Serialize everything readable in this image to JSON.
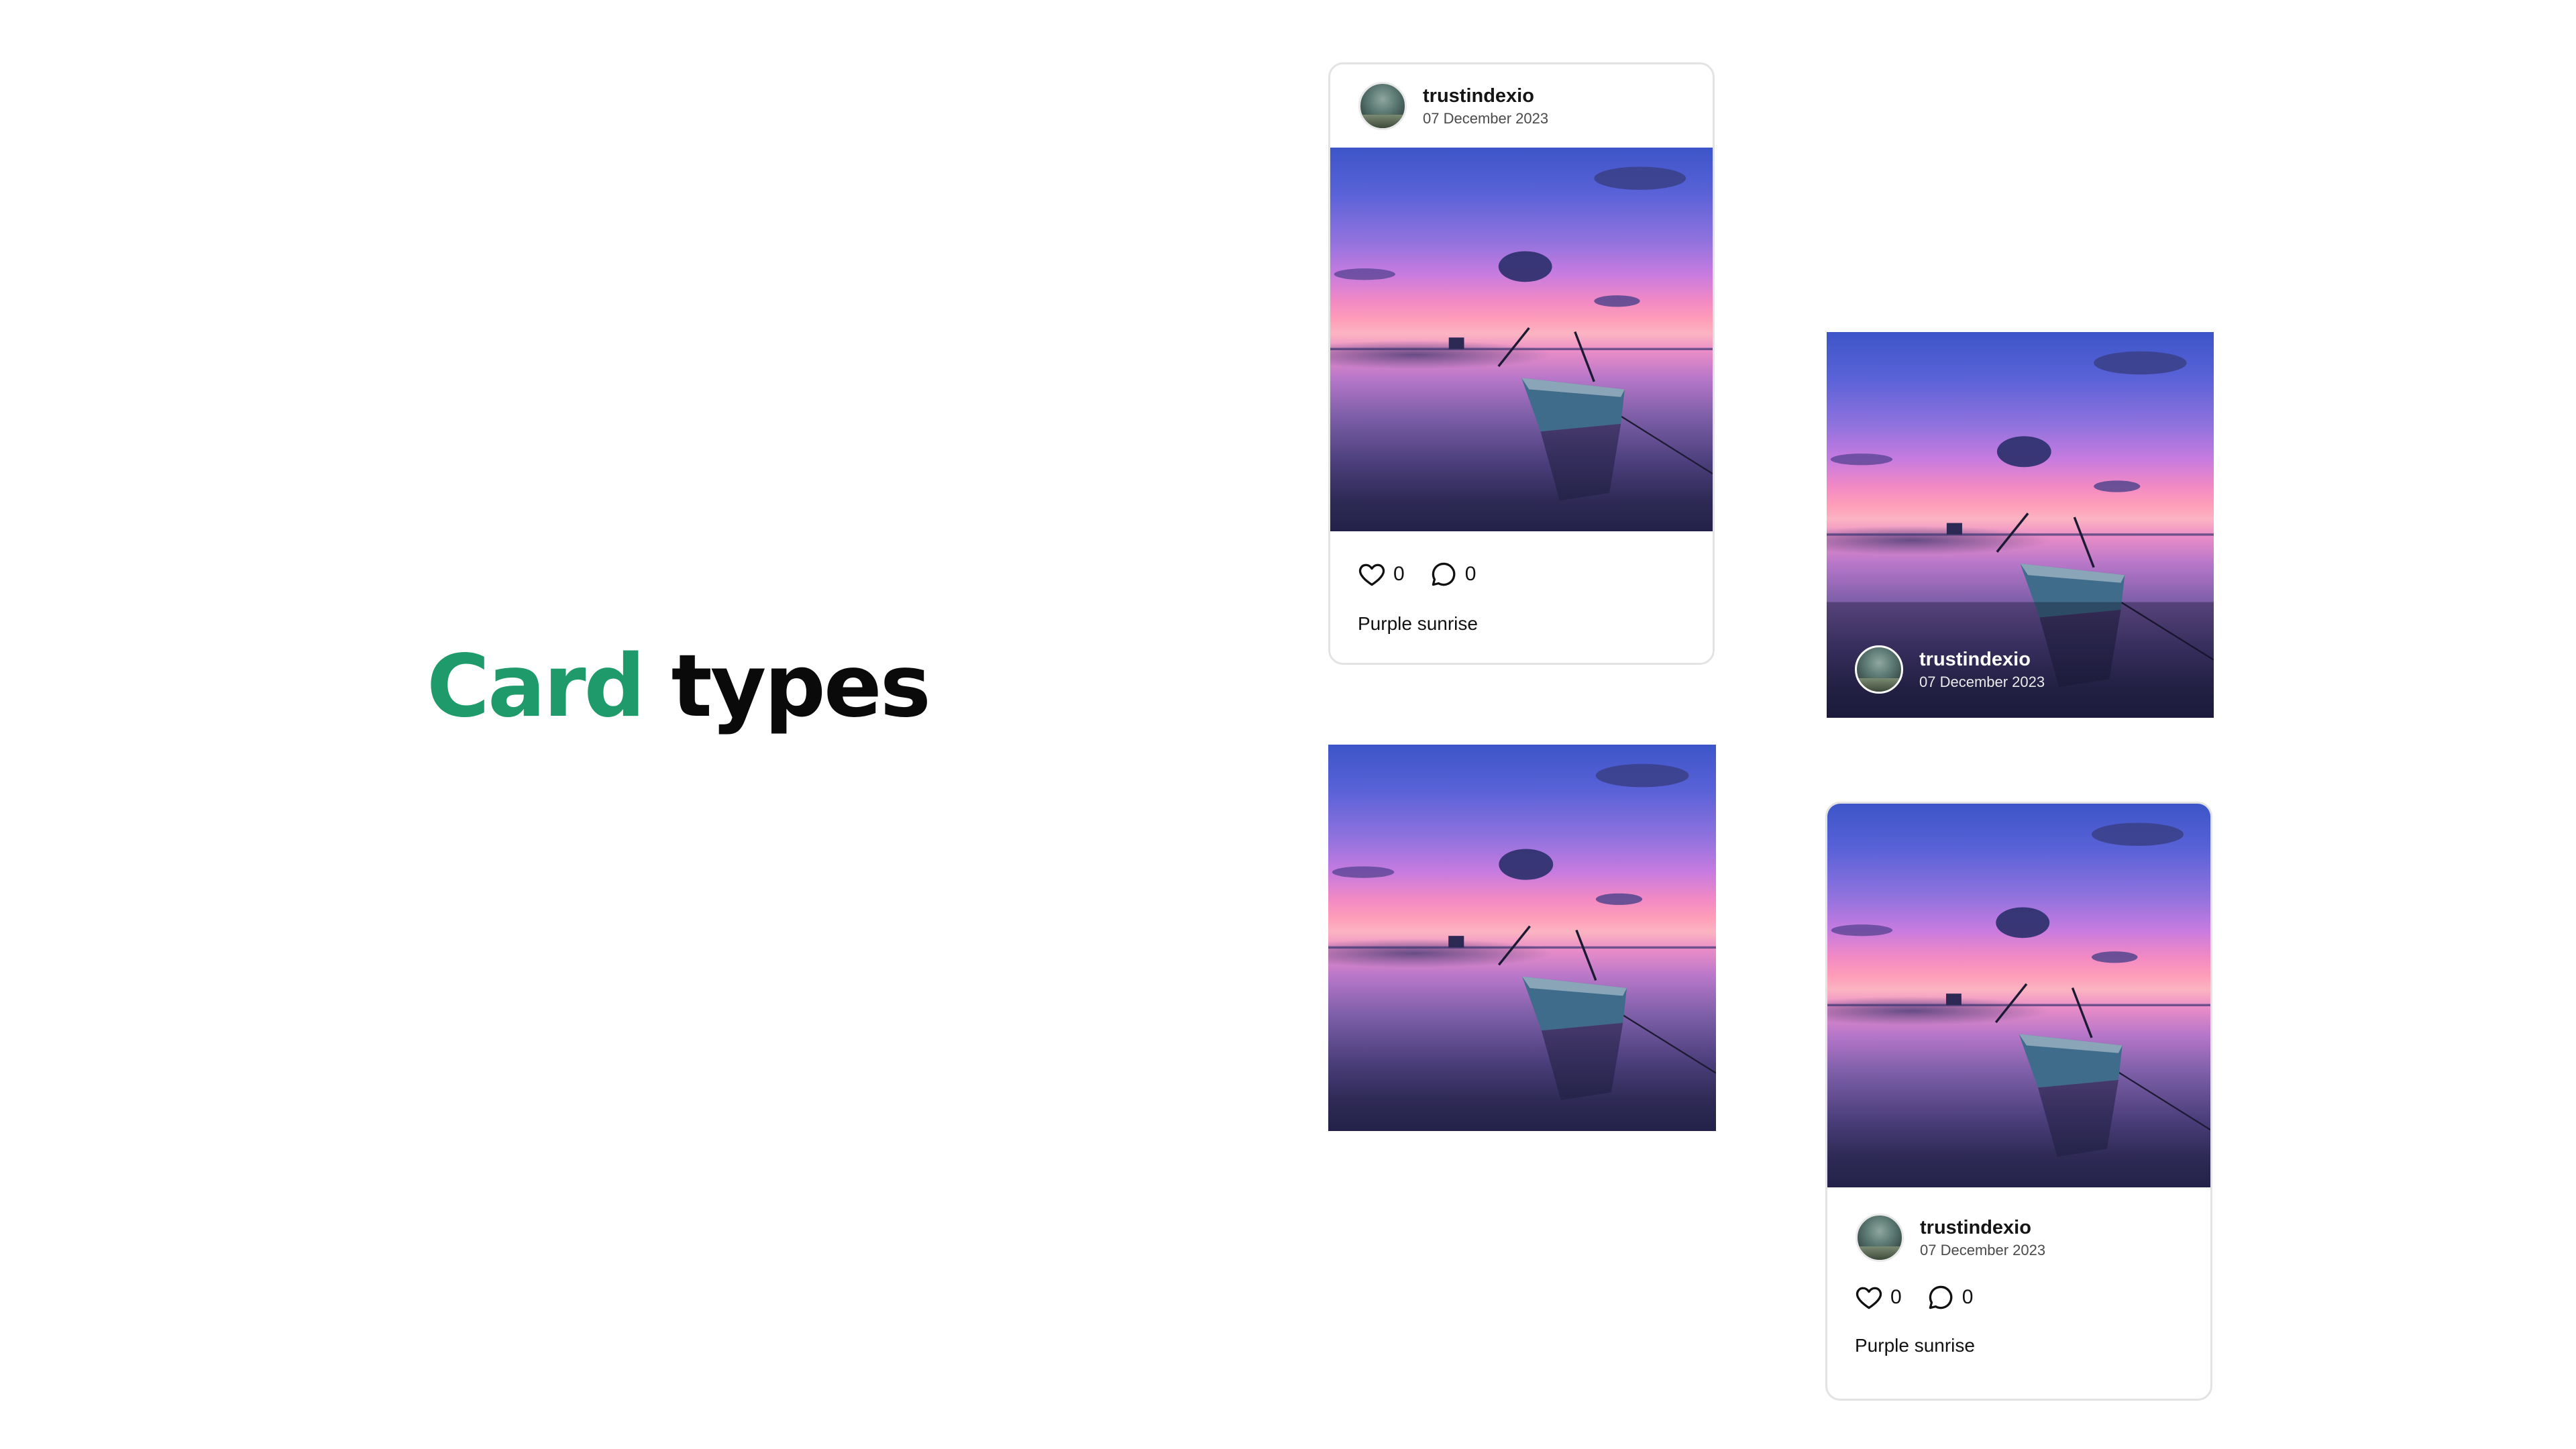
{
  "heading": {
    "accent_word": "Card",
    "rest_word": " types",
    "accent_color": "#1f9b6b"
  },
  "post": {
    "username": "trustindexio",
    "date": "07 December 2023",
    "likes": "0",
    "comments": "0",
    "caption": "Purple sunrise",
    "avatar_icon": "avatar-photo",
    "like_icon": "heart-outline-icon",
    "comment_icon": "speech-bubble-outline-icon"
  }
}
